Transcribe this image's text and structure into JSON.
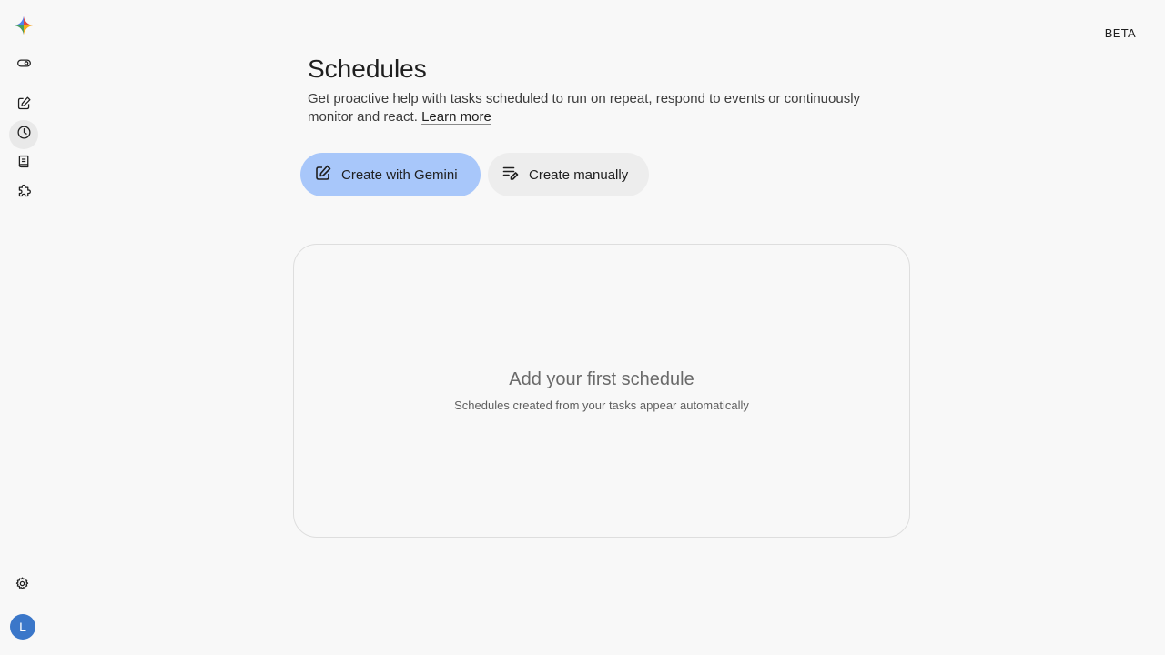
{
  "header": {
    "badge": "BETA"
  },
  "sidebar": {
    "items": [
      {
        "name": "toggle",
        "icon": "toggle-icon"
      },
      {
        "name": "new-task",
        "icon": "edit-icon"
      },
      {
        "name": "schedules",
        "icon": "clock-icon",
        "active": true
      },
      {
        "name": "documents",
        "icon": "document-icon"
      },
      {
        "name": "extensions",
        "icon": "puzzle-icon"
      }
    ],
    "settings_icon": "gear-icon",
    "avatar_initial": "L"
  },
  "main": {
    "title": "Schedules",
    "description": "Get proactive help with tasks scheduled to run on repeat, respond to events or continuously monitor and react.",
    "learn_more": "Learn more",
    "actions": {
      "create_gemini": "Create with Gemini",
      "create_manual": "Create manually"
    },
    "empty_state": {
      "title": "Add your first schedule",
      "subtitle": "Schedules created from your tasks appear automatically"
    }
  },
  "colors": {
    "primary_button": "#a8c7fa",
    "secondary_button": "#ededed",
    "avatar": "#3b77c9",
    "background": "#f8f8f8"
  }
}
